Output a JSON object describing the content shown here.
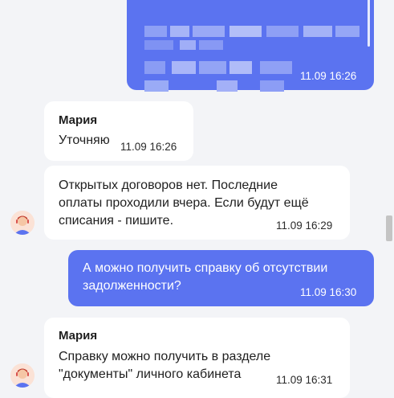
{
  "messages": [
    {
      "type": "outgoing",
      "text": "",
      "time": "11.09 16:26"
    },
    {
      "type": "incoming",
      "sender": "Мария",
      "text": "Уточняю",
      "time": "11.09 16:26"
    },
    {
      "type": "incoming",
      "sender": "",
      "text_lines": [
        "Открытых договоров нет. Последние",
        "оплаты проходили вчера. Если будут ещё",
        "списания - пишите."
      ],
      "time": "11.09 16:29"
    },
    {
      "type": "outgoing",
      "text_lines": [
        "А можно получить справку об отсутствии",
        "задолженности?"
      ],
      "time": "11.09 16:30"
    },
    {
      "type": "incoming",
      "sender": "Мария",
      "text_lines": [
        "Справку можно получить в разделе",
        "\"документы\" личного кабинета"
      ],
      "time": "11.09 16:31"
    }
  ],
  "colors": {
    "outgoing": "#5b73f0",
    "incoming": "#ffffff",
    "background": "#f3f4f7"
  },
  "icons": {
    "avatar": "agent-avatar-icon"
  }
}
